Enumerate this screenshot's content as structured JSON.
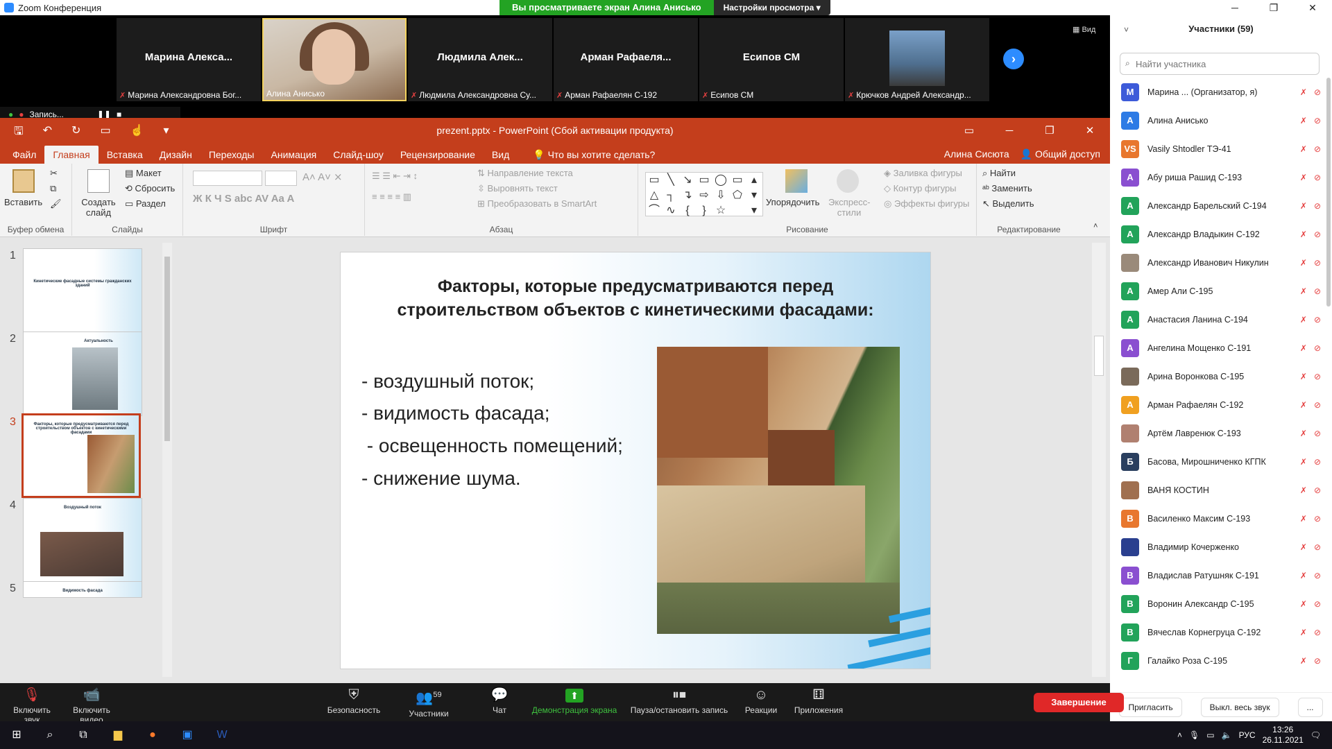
{
  "zoom": {
    "window_title": "Zoom Конференция",
    "viewing_banner": "Вы просматриваете экран Алина Анисько",
    "view_settings": "Настройки просмотра ▾",
    "view_label": "Вид",
    "recording": "Запись...",
    "tiles": [
      {
        "name": "Марина  Алекса...",
        "label": "Марина Александровна Бог..."
      },
      {
        "name": "",
        "label": "Алина Анисько"
      },
      {
        "name": "Людмила  Алек...",
        "label": "Людмила Александровна Су..."
      },
      {
        "name": "Арман  Рафаеля...",
        "label": "Арман Рафаелян С-192"
      },
      {
        "name": "Есипов СМ",
        "label": "Есипов СМ"
      },
      {
        "name": "",
        "label": "Крючков Андрей Александр..."
      }
    ],
    "toolbar": {
      "unmute": "Включить звук",
      "start_video": "Включить видео",
      "security": "Безопасность",
      "participants": "Участники",
      "participants_count": "59",
      "chat": "Чат",
      "share_screen": "Демонстрация экрана",
      "pause_record": "Пауза/остановить запись",
      "reactions": "Реакции",
      "apps": "Приложения",
      "end": "Завершение"
    },
    "participants_panel": {
      "title": "Участники (59)",
      "search_placeholder": "Найти участника",
      "invite": "Пригласить",
      "mute_all": "Выкл. весь звук",
      "more": "...",
      "list": [
        {
          "initials": "М",
          "name": "Марина ...  (Организатор, я)",
          "color": "#3d5bd9"
        },
        {
          "initials": "А",
          "name": "Алина Анисько",
          "color": "#2d7be5"
        },
        {
          "initials": "VS",
          "name": "Vasily Shtodler ТЭ-41",
          "color": "#e8772e"
        },
        {
          "initials": "А",
          "name": "Абу риша Рашид С-193",
          "color": "#8a4fd0"
        },
        {
          "initials": "А",
          "name": "Александр Барельский С-194",
          "color": "#22a35a"
        },
        {
          "initials": "А",
          "name": "Александр Владыкин С-192",
          "color": "#22a35a"
        },
        {
          "initials": "",
          "name": "Александр Иванович Никулин",
          "color": "#9a8a7a"
        },
        {
          "initials": "А",
          "name": "Амер Али С-195",
          "color": "#22a35a"
        },
        {
          "initials": "А",
          "name": "Анастасия Ланина С-194",
          "color": "#22a35a"
        },
        {
          "initials": "А",
          "name": "Ангелина Мощенко С-191",
          "color": "#8a4fd0"
        },
        {
          "initials": "",
          "name": "Арина Воронкова С-195",
          "color": "#7a6a5a"
        },
        {
          "initials": "А",
          "name": "Арман Рафаелян С-192",
          "color": "#f0a020"
        },
        {
          "initials": "",
          "name": "Артём Лавренюк С-193",
          "color": "#b08070"
        },
        {
          "initials": "Б",
          "name": "Басова, Мирошниченко КГПК",
          "color": "#2a3f5f"
        },
        {
          "initials": "",
          "name": "ВАНЯ КОСТИН",
          "color": "#a07050"
        },
        {
          "initials": "В",
          "name": "Василенко Максим С-193",
          "color": "#e8772e"
        },
        {
          "initials": "",
          "name": "Владимир Кочерженко",
          "color": "#2a3f8f"
        },
        {
          "initials": "В",
          "name": "Владислав Ратушняк С-191",
          "color": "#8a4fd0"
        },
        {
          "initials": "В",
          "name": "Воронин Александр С-195",
          "color": "#22a35a"
        },
        {
          "initials": "В",
          "name": "Вячеслав Корнегруца С-192",
          "color": "#22a35a"
        },
        {
          "initials": "Г",
          "name": "Галайко Роза С-195",
          "color": "#22a35a"
        }
      ]
    }
  },
  "ppt": {
    "title": "prezent.pptx - PowerPoint (Сбой активации продукта)",
    "tabs": [
      "Файл",
      "Главная",
      "Вставка",
      "Дизайн",
      "Переходы",
      "Анимация",
      "Слайд-шоу",
      "Рецензирование",
      "Вид"
    ],
    "tell_me": "Что вы хотите сделать?",
    "user": "Алина Сисюта",
    "share": "Общий доступ",
    "ribbon": {
      "paste": "Вставить",
      "clipboard": "Буфер обмена",
      "new_slide": "Создать слайд",
      "layout": "Макет",
      "reset": "Сбросить",
      "section": "Раздел",
      "slides": "Слайды",
      "font": "Шрифт",
      "text_direction": "Направление текста",
      "align_text": "Выровнять текст",
      "smartart": "Преобразовать в SmartArt",
      "paragraph": "Абзац",
      "arrange": "Упорядочить",
      "quick_styles": "Экспресс-стили",
      "shape_fill": "Заливка фигуры",
      "shape_outline": "Контур фигуры",
      "shape_effects": "Эффекты фигуры",
      "drawing": "Рисование",
      "find": "Найти",
      "replace": "Заменить",
      "select": "Выделить",
      "editing": "Редактирование"
    },
    "thumbnails": [
      {
        "num": "1",
        "text": "Кинетические фасадные системы гражданских зданий"
      },
      {
        "num": "2",
        "text": "Актуальность"
      },
      {
        "num": "3",
        "text": "Факторы, которые предусматриваются перед строительством объектов с кинетическими фасадами"
      },
      {
        "num": "4",
        "text": "Воздушный поток"
      },
      {
        "num": "5",
        "text": "Видимость фасада"
      }
    ],
    "slide": {
      "title": "Факторы, которые предусматриваются перед строительством объектов с кинетическими фасадами:",
      "bullets": [
        "- воздушный поток;",
        "- видимость фасада;",
        " - освещенность помещений;",
        "- снижение шума."
      ]
    }
  },
  "taskbar": {
    "lang": "РУС",
    "time": "13:26",
    "date": "26.11.2021"
  }
}
